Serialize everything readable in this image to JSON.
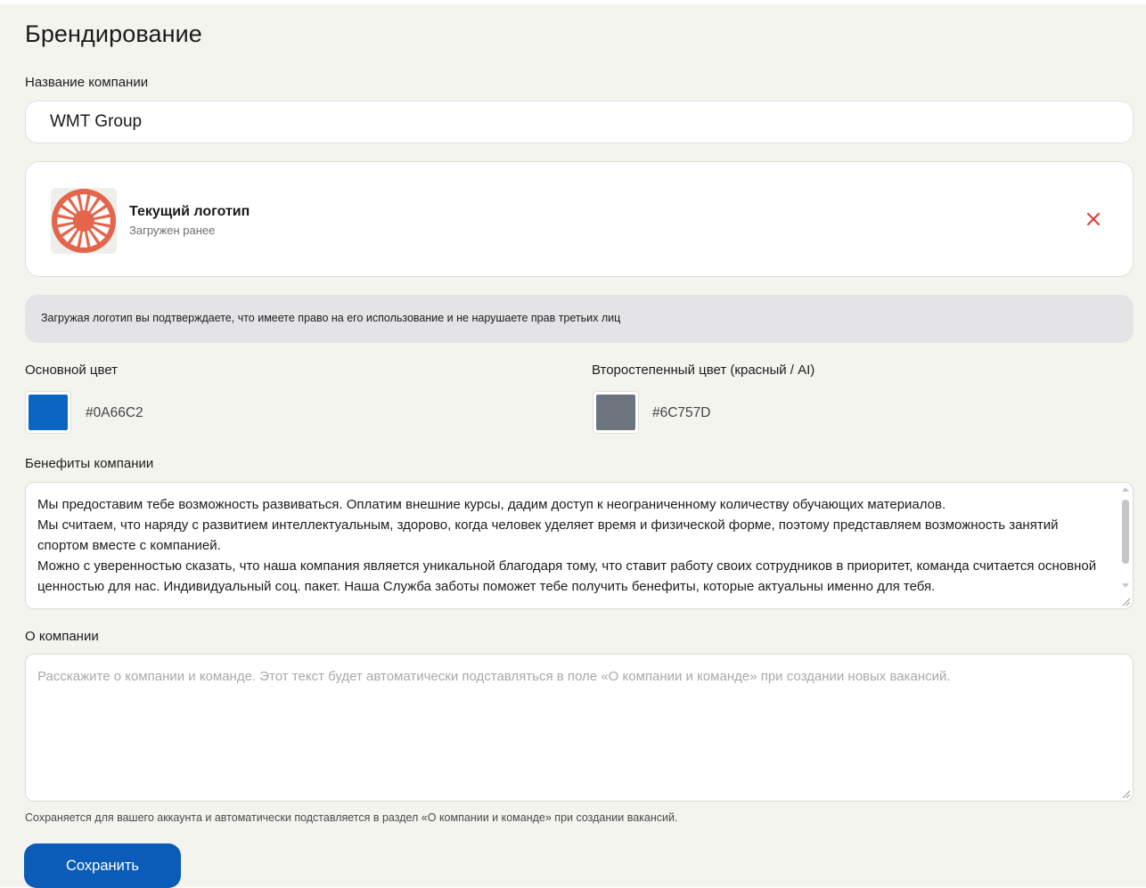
{
  "page": {
    "title": "Брендирование"
  },
  "company_name": {
    "label": "Название компании",
    "value": "WMT Group"
  },
  "logo": {
    "title": "Текущий логотип",
    "subtitle": "Загружен ранее",
    "icon": "sunburst-logo",
    "remove_icon": "close-icon",
    "remove_color": "#e03a3a"
  },
  "notice": {
    "text": "Загружая логотип вы подтверждаете, что имеете право на его использование и не нарушаете прав третьих лиц"
  },
  "colors": {
    "primary": {
      "label": "Основной цвет",
      "value": "#0A66C2"
    },
    "secondary": {
      "label": "Второстепенный цвет (красный / AI)",
      "value": "#6C757D"
    }
  },
  "benefits": {
    "label": "Бенефиты компании",
    "value": "Мы предоставим тебе возможность развиваться. Оплатим внешние курсы, дадим доступ к неограниченному количеству обучающих материалов.\nМы считаем, что наряду с развитием интеллектуальным, здорово, когда человек уделяет время и физической форме, поэтому представляем возможность занятий спортом вместе с компанией.\nМожно с уверенностью сказать, что наша компания является уникальной благодаря тому, что ставит работу своих сотрудников в приоритет, команда считается основной ценностью для нас. Индивидуальный соц. пакет. Наша Служба заботы поможет тебе получить бенефиты, которые актуальны именно для тебя."
  },
  "about": {
    "label": "О компании",
    "placeholder": "Расскажите о компании и команде. Этот текст будет автоматически подставляться в поле «О компании и команде» при создании новых вакансий.",
    "hint": "Сохраняется для вашего аккаунта и автоматически подставляется в раздел «О компании и команде» при создании вакансий."
  },
  "actions": {
    "save_label": "Сохранить",
    "accent": "#0A5CB8"
  }
}
